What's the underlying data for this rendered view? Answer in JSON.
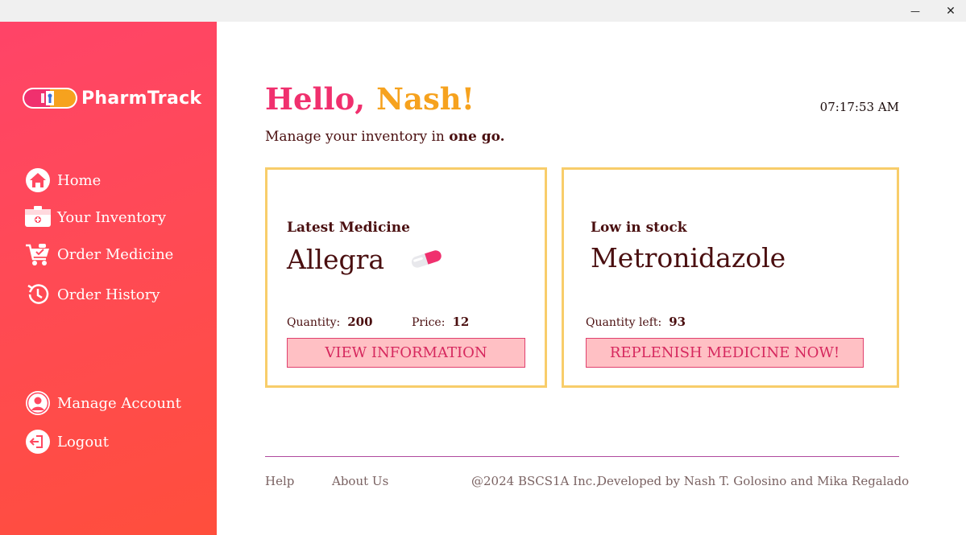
{
  "window": {
    "minimize_glyph": "—",
    "close_glyph": "✕"
  },
  "sidebar": {
    "brand": "PharmTrack",
    "nav": [
      {
        "label": "Home",
        "icon": "home-icon"
      },
      {
        "label": "Your Inventory",
        "icon": "inventory-icon"
      },
      {
        "label": "Order Medicine",
        "icon": "cart-icon"
      },
      {
        "label": "Order History",
        "icon": "history-icon"
      }
    ],
    "account": [
      {
        "label": "Manage Account",
        "icon": "user-icon"
      },
      {
        "label": "Logout",
        "icon": "logout-icon"
      }
    ]
  },
  "header": {
    "hello": "Hello,",
    "name": "Nash!",
    "time": "07:17:53 AM",
    "subtitle_prefix": "Manage your inventory in ",
    "subtitle_bold": "one go."
  },
  "latest": {
    "label": "Latest Medicine",
    "name": "Allegra",
    "quantity_label": "Quantity:",
    "quantity": "200",
    "price_label": "Price:",
    "price": "12",
    "button": "VIEW INFORMATION"
  },
  "low_stock": {
    "label": "Low in stock",
    "name": "Metronidazole",
    "quantity_label": "Quantity left:",
    "quantity": "93",
    "button": "REPLENISH MEDICINE NOW!"
  },
  "footer": {
    "help": "Help",
    "about": "About Us",
    "copyright": "@2024 BSCS1A Inc.,",
    "developed": "Developed by Nash T. Golosino and Mika Regalado"
  },
  "colors": {
    "sidebar_top": "#ff4468",
    "sidebar_bottom": "#ff4e3c",
    "hello": "#f0306e",
    "name": "#f6a21e",
    "card_border": "#f8cd6a",
    "button_fill": "#ffc0c4",
    "button_text": "#d6285e",
    "text_dark": "#4a0f10"
  }
}
